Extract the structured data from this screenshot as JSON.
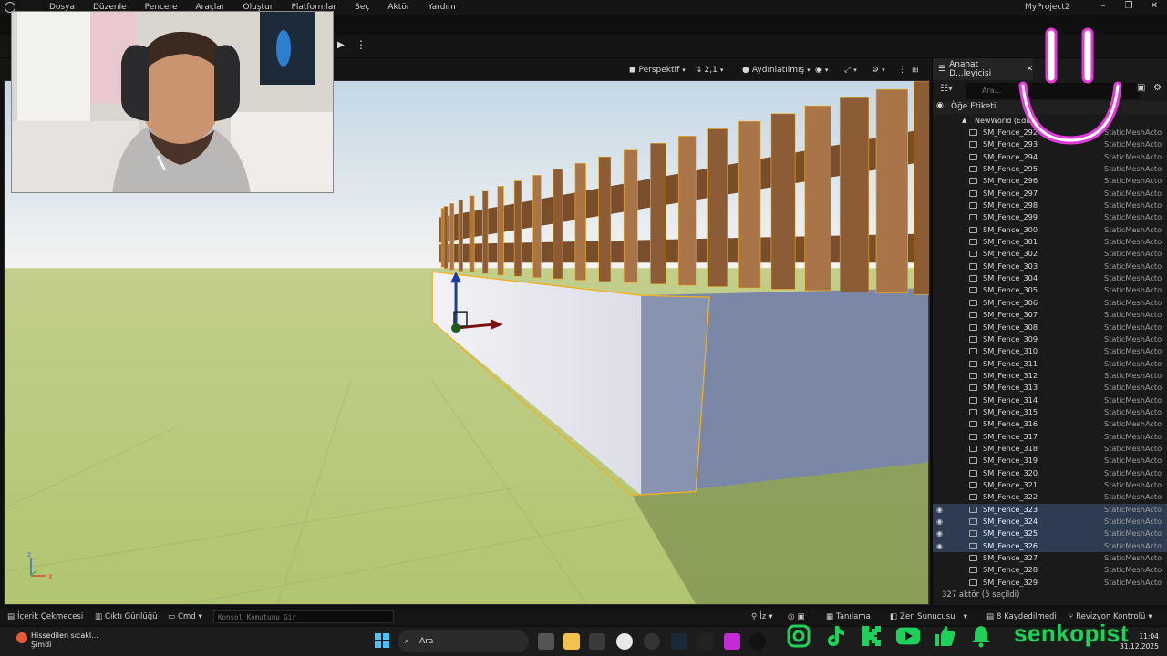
{
  "menu": {
    "items": [
      "Dosya",
      "Düzenle",
      "Pencere",
      "Araçlar",
      "Oluştur",
      "Platformlar",
      "Seç",
      "Aktör",
      "Yardım"
    ],
    "project": "MyProject2"
  },
  "viewport": {
    "view_mode": "Perspektif",
    "camera_speed": "2,1",
    "lighting": "Aydınlatılmış",
    "axis_z": "z",
    "axis_x": "x"
  },
  "outliner": {
    "tab_title": "Anahat D...leyicisi",
    "search_placeholder": "Ara...",
    "header_label": "Öğe Etiketi",
    "world_label": "NewWorld (Edito",
    "rows": [
      {
        "name": "SM_Fence_292",
        "type": "StaticMeshActo",
        "selected": false
      },
      {
        "name": "SM_Fence_293",
        "type": "StaticMeshActo",
        "selected": false
      },
      {
        "name": "SM_Fence_294",
        "type": "StaticMeshActo",
        "selected": false
      },
      {
        "name": "SM_Fence_295",
        "type": "StaticMeshActo",
        "selected": false
      },
      {
        "name": "SM_Fence_296",
        "type": "StaticMeshActo",
        "selected": false
      },
      {
        "name": "SM_Fence_297",
        "type": "StaticMeshActo",
        "selected": false
      },
      {
        "name": "SM_Fence_298",
        "type": "StaticMeshActo",
        "selected": false
      },
      {
        "name": "SM_Fence_299",
        "type": "StaticMeshActo",
        "selected": false
      },
      {
        "name": "SM_Fence_300",
        "type": "StaticMeshActo",
        "selected": false
      },
      {
        "name": "SM_Fence_301",
        "type": "StaticMeshActo",
        "selected": false
      },
      {
        "name": "SM_Fence_302",
        "type": "StaticMeshActo",
        "selected": false
      },
      {
        "name": "SM_Fence_303",
        "type": "StaticMeshActo",
        "selected": false
      },
      {
        "name": "SM_Fence_304",
        "type": "StaticMeshActo",
        "selected": false
      },
      {
        "name": "SM_Fence_305",
        "type": "StaticMeshActo",
        "selected": false
      },
      {
        "name": "SM_Fence_306",
        "type": "StaticMeshActo",
        "selected": false
      },
      {
        "name": "SM_Fence_307",
        "type": "StaticMeshActo",
        "selected": false
      },
      {
        "name": "SM_Fence_308",
        "type": "StaticMeshActo",
        "selected": false
      },
      {
        "name": "SM_Fence_309",
        "type": "StaticMeshActo",
        "selected": false
      },
      {
        "name": "SM_Fence_310",
        "type": "StaticMeshActo",
        "selected": false
      },
      {
        "name": "SM_Fence_311",
        "type": "StaticMeshActo",
        "selected": false
      },
      {
        "name": "SM_Fence_312",
        "type": "StaticMeshActo",
        "selected": false
      },
      {
        "name": "SM_Fence_313",
        "type": "StaticMeshActo",
        "selected": false
      },
      {
        "name": "SM_Fence_314",
        "type": "StaticMeshActo",
        "selected": false
      },
      {
        "name": "SM_Fence_315",
        "type": "StaticMeshActo",
        "selected": false
      },
      {
        "name": "SM_Fence_316",
        "type": "StaticMeshActo",
        "selected": false
      },
      {
        "name": "SM_Fence_317",
        "type": "StaticMeshActo",
        "selected": false
      },
      {
        "name": "SM_Fence_318",
        "type": "StaticMeshActo",
        "selected": false
      },
      {
        "name": "SM_Fence_319",
        "type": "StaticMeshActo",
        "selected": false
      },
      {
        "name": "SM_Fence_320",
        "type": "StaticMeshActo",
        "selected": false
      },
      {
        "name": "SM_Fence_321",
        "type": "StaticMeshActo",
        "selected": false
      },
      {
        "name": "SM_Fence_322",
        "type": "StaticMeshActo",
        "selected": false
      },
      {
        "name": "SM_Fence_323",
        "type": "StaticMeshActo",
        "selected": true
      },
      {
        "name": "SM_Fence_324",
        "type": "StaticMeshActo",
        "selected": true
      },
      {
        "name": "SM_Fence_325",
        "type": "StaticMeshActo",
        "selected": true
      },
      {
        "name": "SM_Fence_326",
        "type": "StaticMeshActo",
        "selected": true
      },
      {
        "name": "SM_Fence_327",
        "type": "StaticMeshActo",
        "selected": false
      },
      {
        "name": "SM_Fence_328",
        "type": "StaticMeshActo",
        "selected": false
      },
      {
        "name": "SM_Fence_329",
        "type": "StaticMeshActo",
        "selected": false
      }
    ],
    "status": "327 aktör (5 seçildi)"
  },
  "bottombar": {
    "content_drawer": "İçerik Çekmecesi",
    "output_log": "Çıktı Günlüğü",
    "cmd": "Cmd",
    "console_placeholder": "Konsol Komutunu Gir",
    "trace": "İz",
    "diagnostics": "Tanılama",
    "zen_server": "Zen Sunucusu",
    "unsaved": "8 Kaydedilmedi",
    "revision": "Revizyon Kontrolü"
  },
  "taskbar": {
    "weather_title": "Hissedilen sıcakl...",
    "weather_sub": "Şimdi",
    "search_label": "Ara",
    "time": "11:04",
    "date": "31.12.2025"
  },
  "overlay": {
    "brand": "senkopist"
  },
  "colors": {
    "selection": "#2e3c52",
    "brand_green": "#1fd05a",
    "brand_pink": "#e23ad8",
    "grass": "#b4c67a",
    "fence": "#9b6a42",
    "wall_selected_outline": "#f0b020"
  }
}
